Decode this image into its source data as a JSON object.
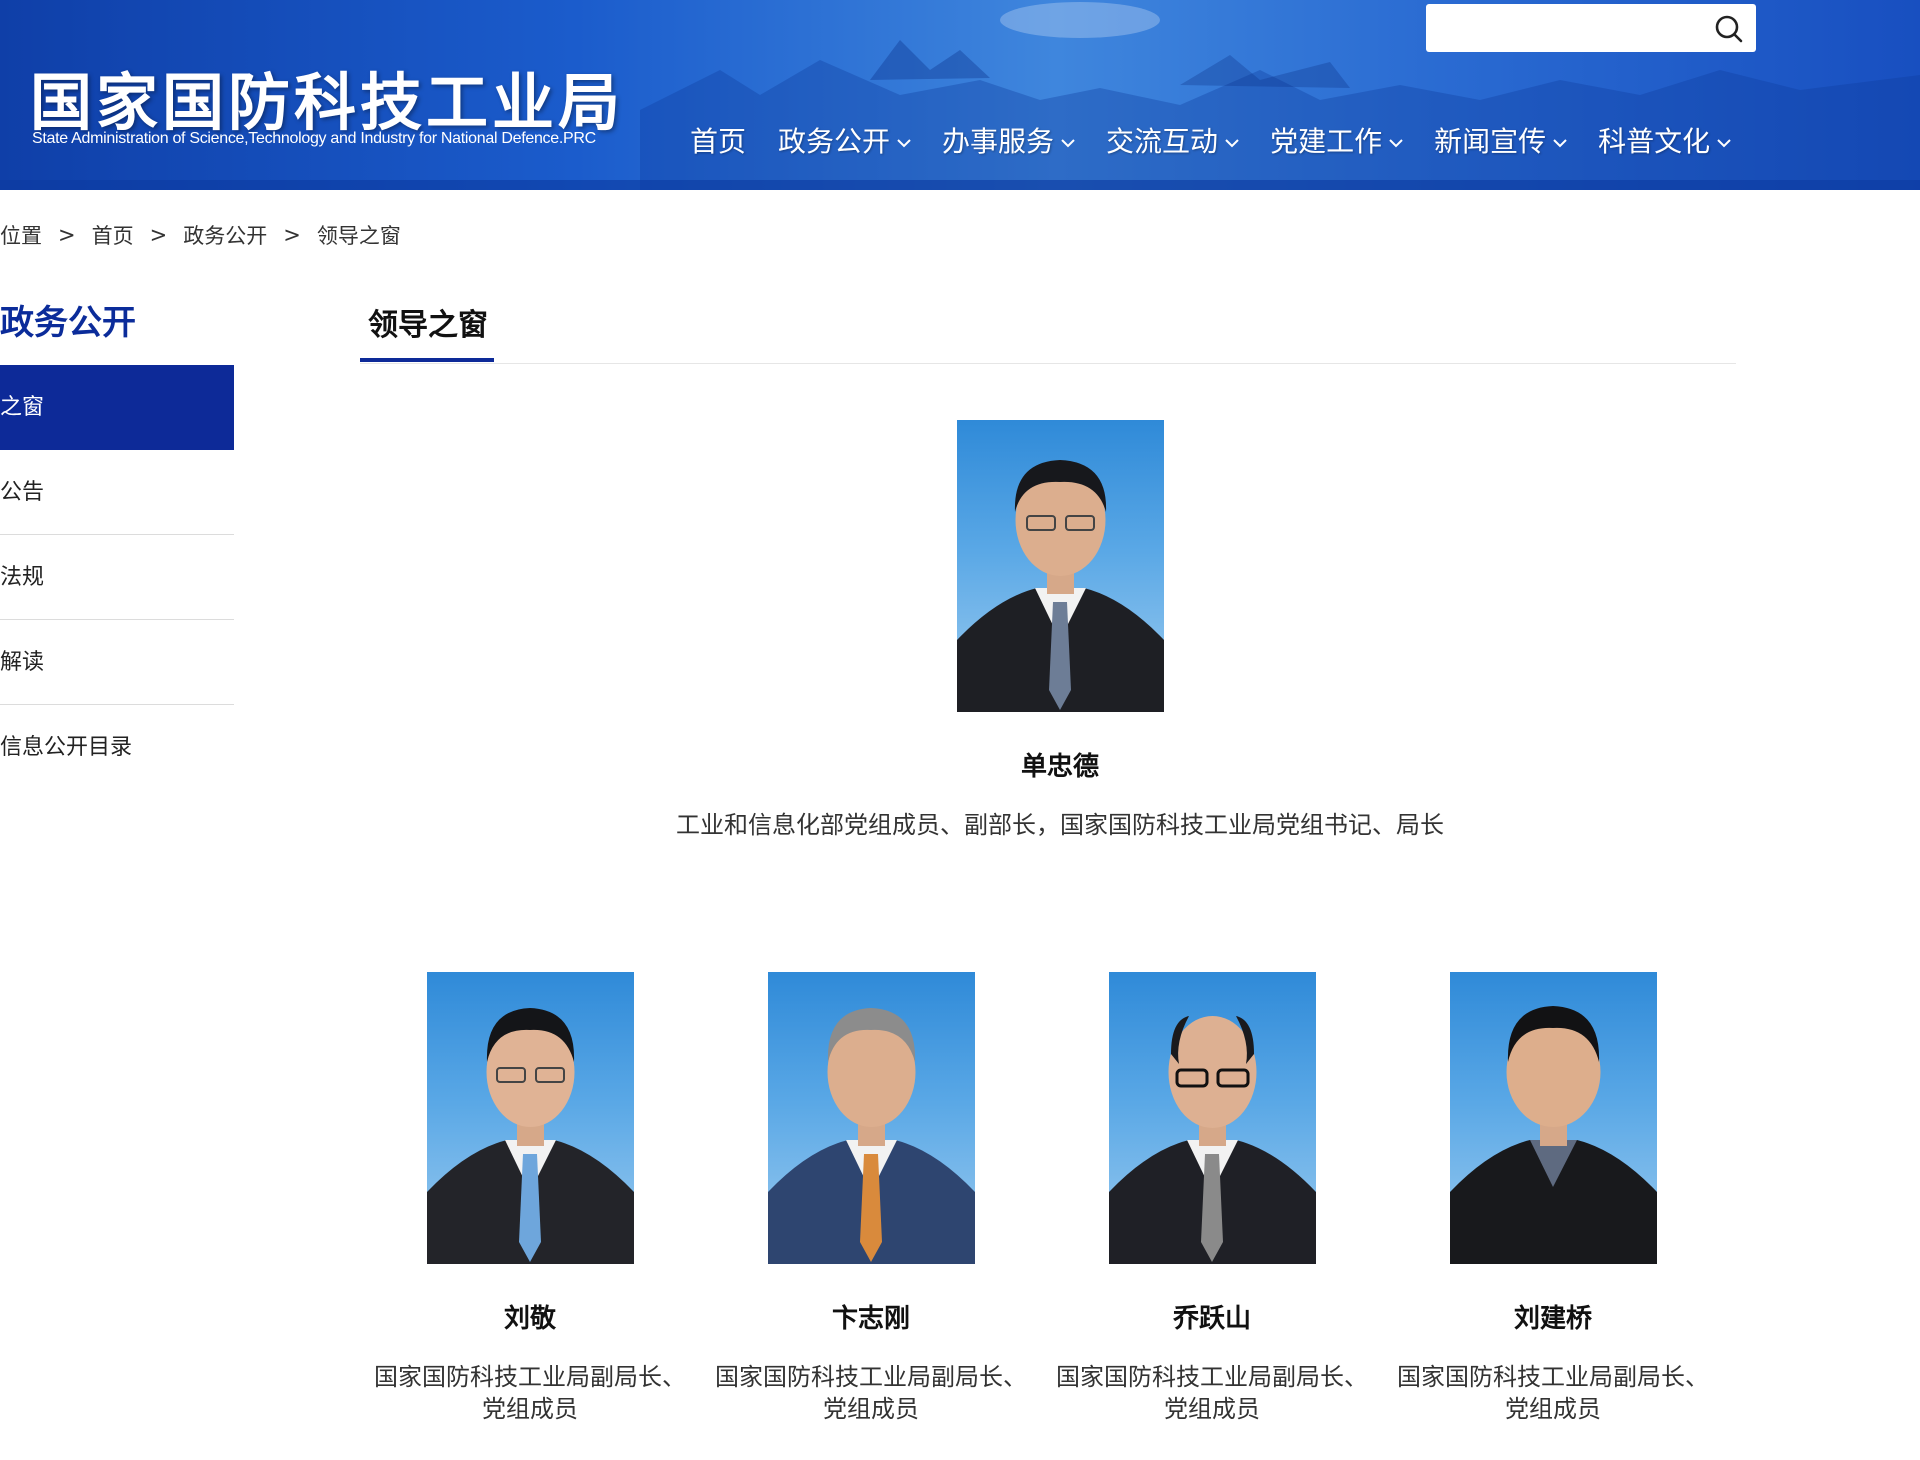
{
  "header": {
    "title": "国家国防科技工业局",
    "subtitle": "State Administration of Science,Technology and Industry for National Defence.PRC",
    "search": {
      "placeholder": ""
    },
    "nav": [
      {
        "label": "首页",
        "has_dropdown": false
      },
      {
        "label": "政务公开",
        "has_dropdown": true
      },
      {
        "label": "办事服务",
        "has_dropdown": true
      },
      {
        "label": "交流互动",
        "has_dropdown": true
      },
      {
        "label": "党建工作",
        "has_dropdown": true
      },
      {
        "label": "新闻宣传",
        "has_dropdown": true
      },
      {
        "label": "科普文化",
        "has_dropdown": true
      }
    ]
  },
  "breadcrumb": {
    "prefix": "位置",
    "items": [
      "首页",
      "政务公开",
      "领导之窗"
    ],
    "separator": ">"
  },
  "sidebar": {
    "title": "政务公开",
    "items": [
      {
        "label": "之窗",
        "active": true
      },
      {
        "label": "公告",
        "active": false
      },
      {
        "label": "法规",
        "active": false
      },
      {
        "label": "解读",
        "active": false
      },
      {
        "label": "信息公开目录",
        "active": false
      }
    ]
  },
  "main": {
    "tab": "领导之窗",
    "leaders": [
      {
        "name": "单忠德",
        "title": "工业和信息化部党组成员、副部长，国家国防科技工业局党组书记、局长"
      },
      {
        "name": "刘敬",
        "title_line1": "国家国防科技工业局副局长、",
        "title_line2": "党组成员"
      },
      {
        "name": "卞志刚",
        "title_line1": "国家国防科技工业局副局长、",
        "title_line2": "党组成员"
      },
      {
        "name": "乔跃山",
        "title_line1": "国家国防科技工业局副局长、",
        "title_line2": "党组成员"
      },
      {
        "name": "刘建桥",
        "title_line1": "国家国防科技工业局副局长、",
        "title_line2": "党组成员"
      }
    ]
  },
  "colors": {
    "brand_blue": "#0d2a98",
    "header_blue": "#1b5ccc",
    "sidebar_title": "#0b2c9a"
  },
  "icons": {
    "search": "search-icon",
    "dropdown": "chevron-down-icon"
  }
}
